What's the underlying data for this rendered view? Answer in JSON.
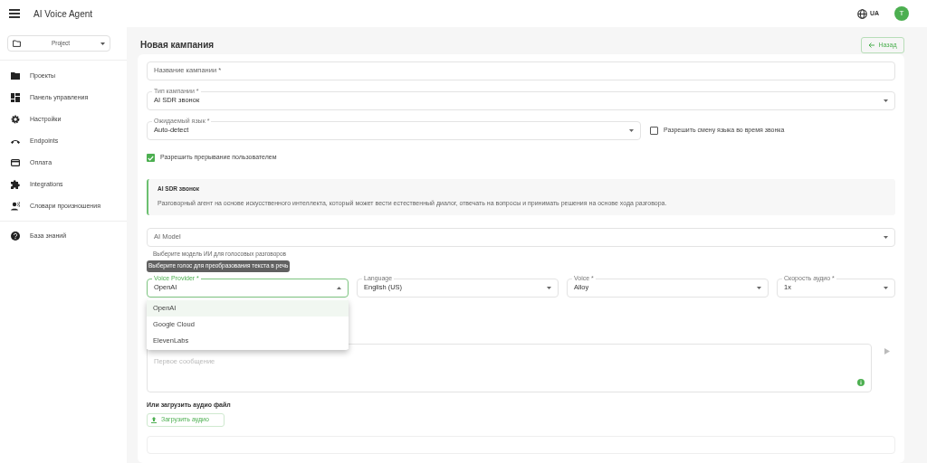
{
  "app_bar": {
    "title": "AI Voice Agent",
    "language": "UA",
    "avatar": "T"
  },
  "sidebar": {
    "project_select": "Project",
    "items": [
      {
        "label": "Проекты"
      },
      {
        "label": "Панель управления"
      },
      {
        "label": "Настройки"
      },
      {
        "label": "Endpoints"
      },
      {
        "label": "Оплата"
      },
      {
        "label": "Integrations"
      },
      {
        "label": "Словари произношения"
      },
      {
        "label": "База знаний"
      }
    ]
  },
  "page": {
    "title": "Новая кампания",
    "back_button": "Назад"
  },
  "form": {
    "campaign_name": {
      "placeholder": "Название кампании *"
    },
    "campaign_type": {
      "label": "Тип кампании *",
      "value": "AI SDR звонок"
    },
    "language": {
      "label": "Ожидаемый язык *",
      "value": "Auto-detect"
    },
    "allow_language_switch": {
      "label": "Разрешить смену языка во время звонка",
      "checked": false
    },
    "allow_interrupt": {
      "label": "Разрешить прерывание пользователем",
      "checked": true
    },
    "info": {
      "title": "AI SDR звонок",
      "text": "Разговорный агент на основе искусственного интеллекта, который может вести естественный диалог, отвечать на вопросы и принимать решения на основе хода разговора."
    },
    "ai_model": {
      "placeholder": "AI Model",
      "helper": "Выберите модель ИИ для голосовых разговоров"
    },
    "tooltip": "Выберите голос для преобразования текста в речь",
    "voice_row": [
      {
        "label": "Voice Provider *",
        "value": "OpenAI",
        "focused": true
      },
      {
        "label": "Language",
        "value": "English (US)",
        "focused": false
      },
      {
        "label": "Voice *",
        "value": "Alloy",
        "focused": false
      },
      {
        "label": "Скорость аудио *",
        "value": "1x",
        "focused": false
      }
    ],
    "provider_options": [
      {
        "label": "OpenAI",
        "selected": true
      },
      {
        "label": "Google Cloud",
        "selected": false
      },
      {
        "label": "ElevenLabs",
        "selected": false
      }
    ],
    "first_message": {
      "placeholder": "Первое сообщение"
    },
    "upload_label": "Или загрузить аудио файл",
    "upload_button": "Загрузить аудио"
  }
}
